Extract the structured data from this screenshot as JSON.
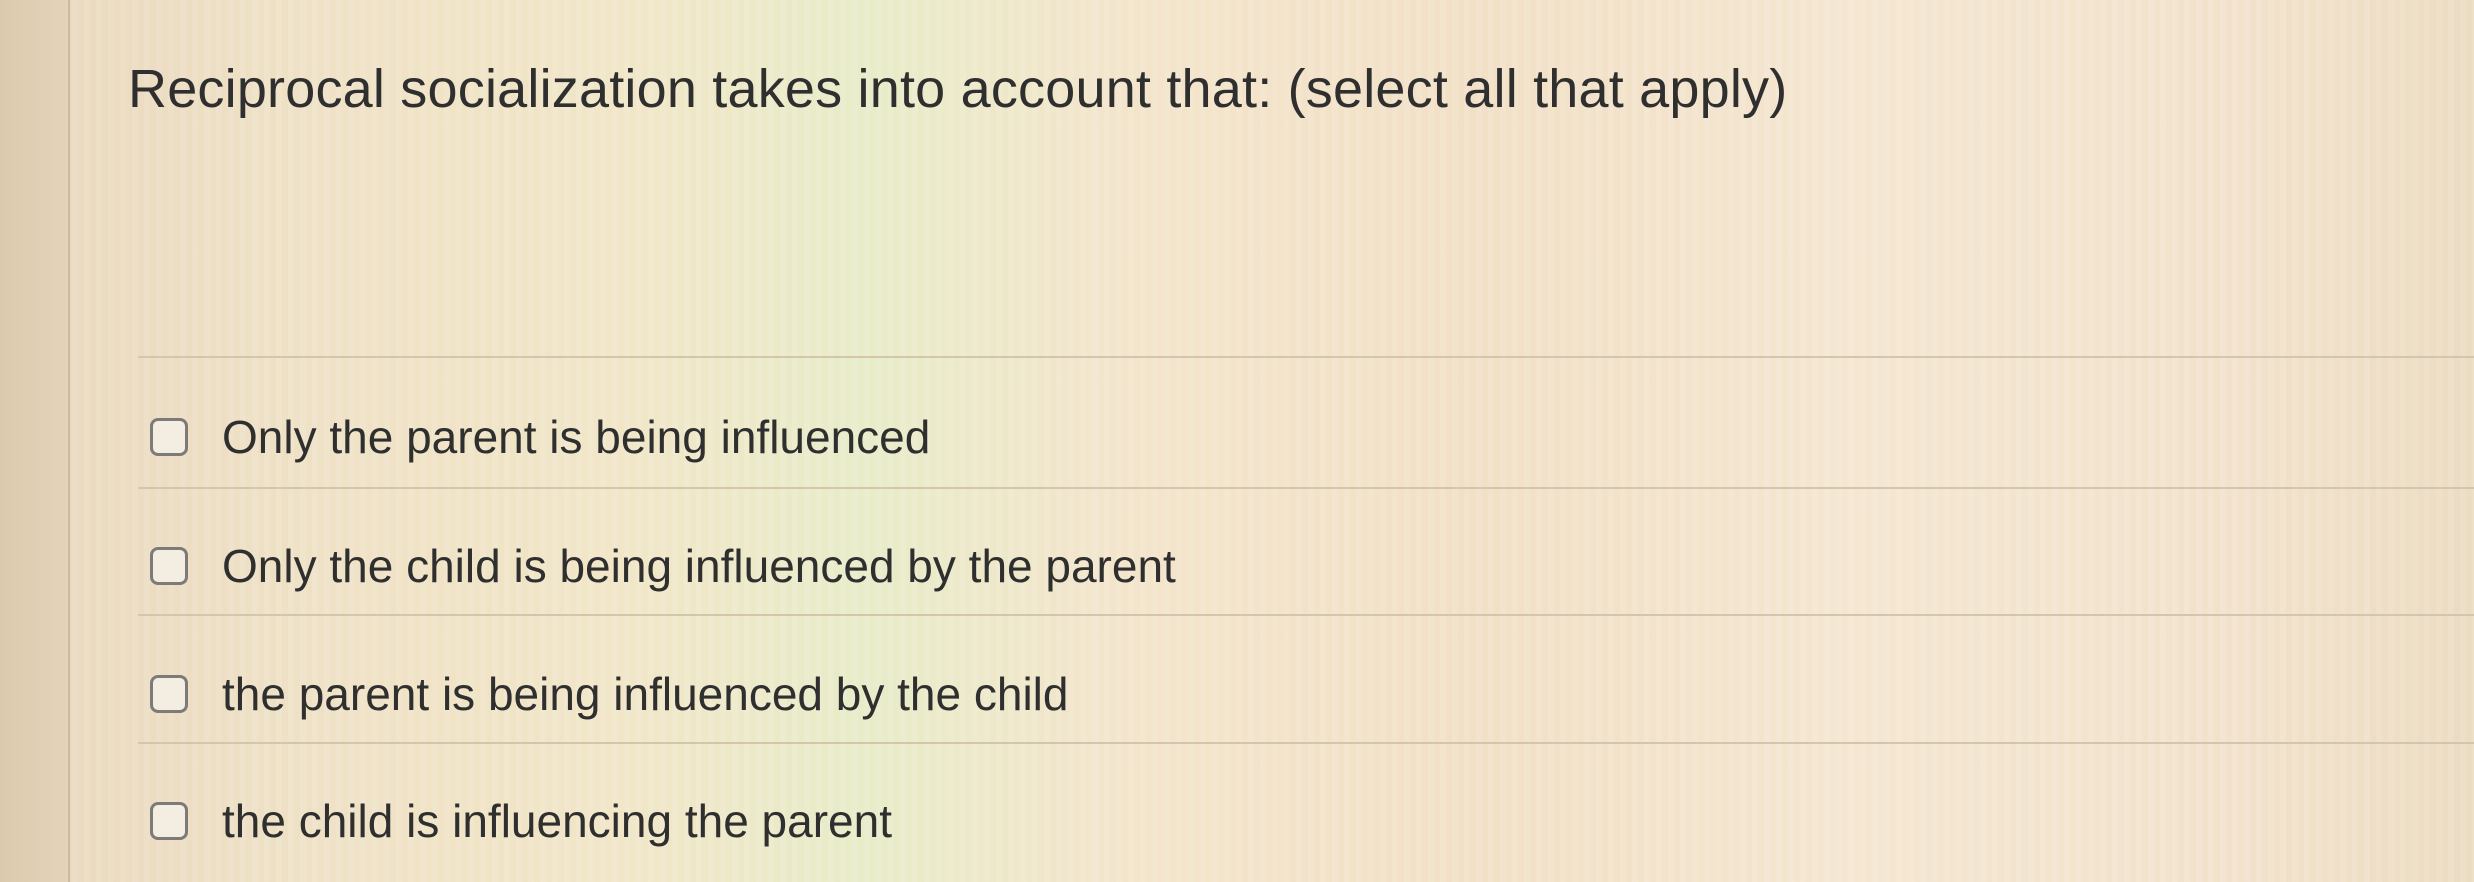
{
  "question": {
    "text": "Reciprocal socialization takes into account that: (select all that apply)"
  },
  "answers": [
    {
      "label": "Only the parent is being influenced",
      "checked": false
    },
    {
      "label": "Only the child is being influenced by the parent",
      "checked": false
    },
    {
      "label": "the parent is being influenced by the child",
      "checked": false
    },
    {
      "label": "the child is influencing the parent",
      "checked": false
    }
  ]
}
